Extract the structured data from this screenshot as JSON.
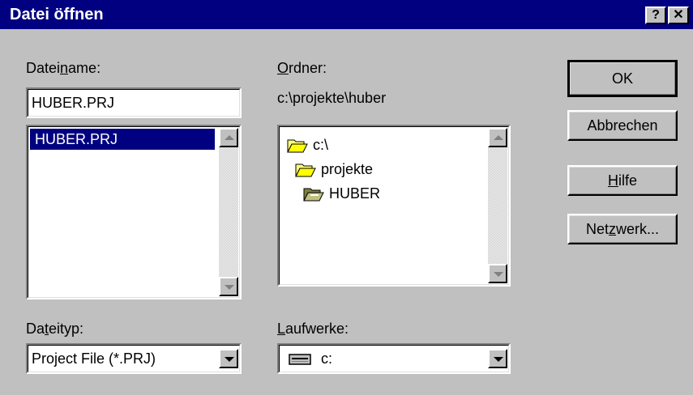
{
  "window": {
    "title": "Datei öffnen",
    "help_button": "?",
    "close_button": "✕"
  },
  "filename": {
    "label_pre": "Datei",
    "label_u": "n",
    "label_post": "ame:",
    "value": "HUBER.PRJ",
    "files": [
      "HUBER.PRJ"
    ]
  },
  "folder": {
    "label_u": "O",
    "label_post": "rdner:",
    "path": "c:\\projekte\\huber",
    "tree": [
      {
        "name": "c:\\",
        "icon": "open-folder-icon"
      },
      {
        "name": "projekte",
        "icon": "open-folder-icon"
      },
      {
        "name": "HUBER",
        "icon": "open-folder-selected-icon"
      }
    ]
  },
  "filetype": {
    "label_pre": "Da",
    "label_u": "t",
    "label_post": "eityp:",
    "value": "Project File (*.PRJ)"
  },
  "drives": {
    "label_u": "L",
    "label_post": "aufwerke:",
    "value": "c:",
    "icon": "drive-icon"
  },
  "buttons": {
    "ok": "OK",
    "cancel": "Abbrechen",
    "help_u": "H",
    "help_post": "ilfe",
    "network_pre": "Net",
    "network_u": "z",
    "network_post": "werk..."
  },
  "colors": {
    "titlebar": "#000080",
    "face": "#c0c0c0",
    "selection": "#000080"
  }
}
